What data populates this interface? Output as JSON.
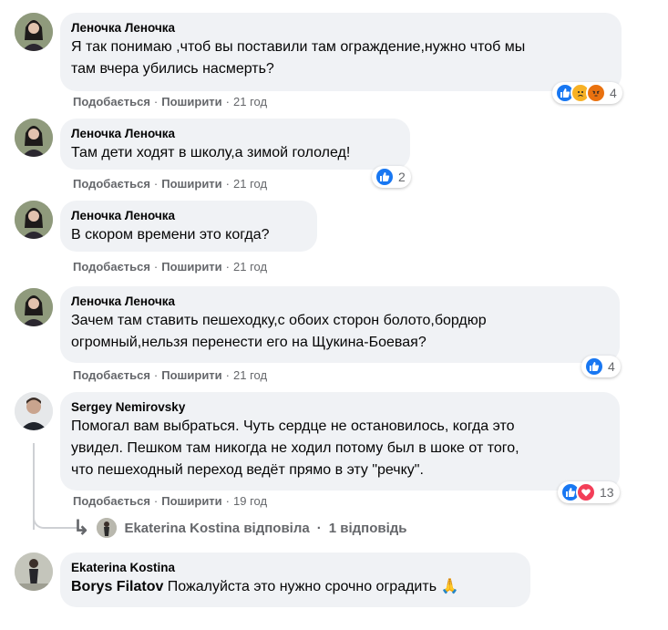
{
  "comments": [
    {
      "author": "Леночка Леночка",
      "lines": [
        "Я так понимаю ,чтоб вы поставили там ограждение,нужно чтоб мы",
        "там вчера убились насмерть?"
      ],
      "like": "Подобається",
      "share": "Поширити",
      "time": "21 год",
      "reactions": [
        "like",
        "sad",
        "angry"
      ],
      "count": "4"
    },
    {
      "author": "Леночка Леночка",
      "lines": [
        "Там дети ходят в школу,а зимой гололед!"
      ],
      "like": "Подобається",
      "share": "Поширити",
      "time": "21 год",
      "reactions": [
        "like"
      ],
      "count": "2"
    },
    {
      "author": "Леночка Леночка",
      "lines": [
        "В скором времени это когда?"
      ],
      "like": "Подобається",
      "share": "Поширити",
      "time": "21 год"
    },
    {
      "author": "Леночка Леночка",
      "lines": [
        "Зачем там ставить пешеходку,с обоих сторон болото,бордюр",
        "огромный,нельзя перенести его на Щукина-Боевая?"
      ],
      "like": "Подобається",
      "share": "Поширити",
      "time": "21 год",
      "reactions": [
        "like"
      ],
      "count": "4"
    },
    {
      "author": "Sergey Nemirovsky",
      "lines": [
        "Помогал вам выбраться. Чуть сердце не остановилось, когда это",
        "увидел. Пешком там никогда не ходил потому был в шоке от того,",
        "что пешеходный переход ведёт прямо в эту \"речку\"."
      ],
      "like": "Подобається",
      "share": "Поширити",
      "time": "19 год",
      "reactions": [
        "like",
        "love"
      ],
      "count": "13"
    },
    {
      "author": "Ekaterina Kostina",
      "mention": "Borys Filatov",
      "text": " Пожалуйста это нужно срочно оградить 🙏"
    }
  ],
  "reply_thread": {
    "replier": "Ekaterina Kostina",
    "replied": "відповіла",
    "separator": "·",
    "count_label": "1 відповідь"
  },
  "colors": {
    "bubble": "#f0f2f5",
    "like": "#1877f2",
    "love": "#f33e58",
    "muted": "#65676b"
  }
}
